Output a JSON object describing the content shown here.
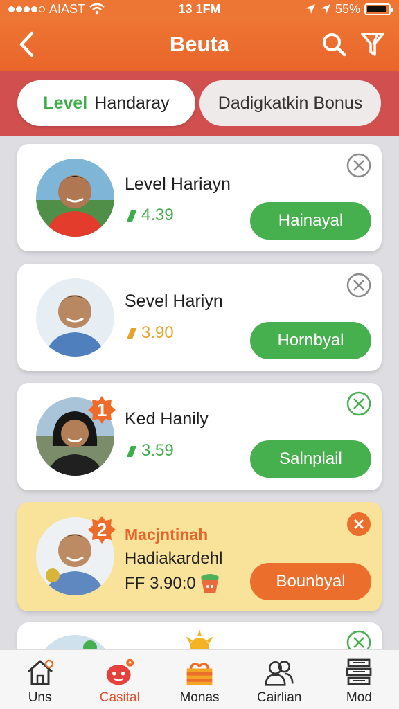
{
  "status_bar": {
    "carrier": "AIAST",
    "time": "13 1FM",
    "battery": "55%"
  },
  "header": {
    "title": "Beuta",
    "icons": [
      "back-chevron-icon",
      "search-icon",
      "filter-icon"
    ]
  },
  "tabs": [
    {
      "accent": "Level",
      "label": "Handaray"
    },
    {
      "label": "Dadigkatkin Bonus"
    }
  ],
  "cards": [
    {
      "name": "Level Hariayn",
      "amount": "4.39",
      "amount_color": "#3fae4a",
      "button": "Hainayal"
    },
    {
      "name": "Sevel Hariyn",
      "amount": "3.90",
      "amount_color": "#e8a22d",
      "button": "Hornbyal"
    },
    {
      "rank": "1",
      "name": "Ked Hanily",
      "amount": "3.59",
      "amount_color": "#3fae4a",
      "button": "Salnplail"
    },
    {
      "rank": "2",
      "title": "Macjntinah",
      "name": "Hadiakardehl",
      "amount": "FF 3.90:0",
      "button": "Bounbyal"
    }
  ],
  "bottom_nav": [
    {
      "label": "Uns",
      "icon": "home-icon"
    },
    {
      "label": "Casital",
      "icon": "mascot-icon",
      "active": true
    },
    {
      "label": "Monas",
      "icon": "gift-icon"
    },
    {
      "label": "Cairlian",
      "icon": "people-icon"
    },
    {
      "label": "Mod",
      "icon": "stack-icon"
    }
  ],
  "colors": {
    "primary": "#ee7634",
    "tab_bar": "#d14f4f",
    "green": "#47b04e",
    "orange_btn": "#ec6e2c",
    "highlight": "#f9e39a"
  }
}
